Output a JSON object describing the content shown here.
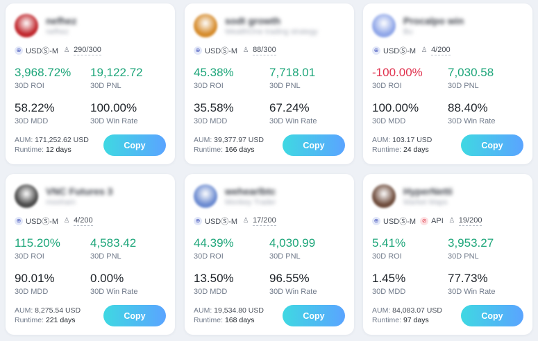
{
  "cards": [
    {
      "name": "nefhez",
      "subtitle": "nefhez",
      "avatar_color": "#c0262c",
      "tags": {
        "currency": "USDⓈ-M",
        "api": null,
        "followers": "290/300"
      },
      "roi": "3,968.72%",
      "roi_label": "30D ROI",
      "roi_color": "#1ea67a",
      "pnl": "19,122.72",
      "pnl_label": "30D PNL",
      "mdd": "58.22%",
      "mdd_label": "30D MDD",
      "win_rate": "100.00%",
      "win_rate_label": "30D Win Rate",
      "aum_label": "AUM:",
      "aum": "171,252.62 USD",
      "runtime_label": "Runtime:",
      "runtime": "12 days",
      "copy_label": "Copy"
    },
    {
      "name": "sodt growth",
      "subtitle": "WealthOne trading strategy",
      "avatar_color": "#d58a2a",
      "tags": {
        "currency": "USDⓈ-M",
        "api": null,
        "followers": "88/300"
      },
      "roi": "45.38%",
      "roi_label": "30D ROI",
      "roi_color": "#1ea67a",
      "pnl": "7,718.01",
      "pnl_label": "30D PNL",
      "mdd": "35.58%",
      "mdd_label": "30D MDD",
      "win_rate": "67.24%",
      "win_rate_label": "30D Win Rate",
      "aum_label": "AUM:",
      "aum": "39,377.97 USD",
      "runtime_label": "Runtime:",
      "runtime": "166 days",
      "copy_label": "Copy"
    },
    {
      "name": "Procalpo win",
      "subtitle": "Bu",
      "avatar_color": "#8fa6e8",
      "tags": {
        "currency": "USDⓈ-M",
        "api": null,
        "followers": "4/200"
      },
      "roi": "-100.00%",
      "roi_label": "30D ROI",
      "roi_color": "#e0334f",
      "pnl": "7,030.58",
      "pnl_label": "30D PNL",
      "mdd": "100.00%",
      "mdd_label": "30D MDD",
      "win_rate": "88.40%",
      "win_rate_label": "30D Win Rate",
      "aum_label": "AUM:",
      "aum": "103.17 USD",
      "runtime_label": "Runtime:",
      "runtime": "24 days",
      "copy_label": "Copy"
    },
    {
      "name": "VNC Futures 3",
      "subtitle": "mooham",
      "avatar_color": "#4a4a4a",
      "tags": {
        "currency": "USDⓈ-M",
        "api": null,
        "followers": "4/200"
      },
      "roi": "115.20%",
      "roi_label": "30D ROI",
      "roi_color": "#1ea67a",
      "pnl": "4,583.42",
      "pnl_label": "30D PNL",
      "mdd": "90.01%",
      "mdd_label": "30D MDD",
      "win_rate": "0.00%",
      "win_rate_label": "30D Win Rate",
      "aum_label": "AUM:",
      "aum": "8,275.54 USD",
      "runtime_label": "Runtime:",
      "runtime": "221 days",
      "copy_label": "Copy"
    },
    {
      "name": "wehearlbtc",
      "subtitle": "Monkey Trader",
      "avatar_color": "#6b8ad0",
      "tags": {
        "currency": "USDⓈ-M",
        "api": null,
        "followers": "17/200"
      },
      "roi": "44.39%",
      "roi_label": "30D ROI",
      "roi_color": "#1ea67a",
      "pnl": "4,030.99",
      "pnl_label": "30D PNL",
      "mdd": "13.50%",
      "mdd_label": "30D MDD",
      "win_rate": "96.55%",
      "win_rate_label": "30D Win Rate",
      "aum_label": "AUM:",
      "aum": "19,534.80 USD",
      "runtime_label": "Runtime:",
      "runtime": "168 days",
      "copy_label": "Copy"
    },
    {
      "name": "HyperNetti",
      "subtitle": "Market Maps",
      "avatar_color": "#6d4a3a",
      "tags": {
        "currency": "USDⓈ-M",
        "api": "API",
        "followers": "19/200"
      },
      "roi": "5.41%",
      "roi_label": "30D ROI",
      "roi_color": "#1ea67a",
      "pnl": "3,953.27",
      "pnl_label": "30D PNL",
      "mdd": "1.45%",
      "mdd_label": "30D MDD",
      "win_rate": "77.73%",
      "win_rate_label": "30D Win Rate",
      "aum_label": "AUM:",
      "aum": "84,083.07 USD",
      "runtime_label": "Runtime:",
      "runtime": "97 days",
      "copy_label": "Copy"
    }
  ],
  "icons": {
    "currency": "futures-icon",
    "api": "api-icon",
    "followers": "user-icon"
  },
  "colors": {
    "positive": "#1ea67a",
    "negative": "#e0334f",
    "button_from": "#3fd8e2",
    "button_to": "#5aa4ff"
  }
}
